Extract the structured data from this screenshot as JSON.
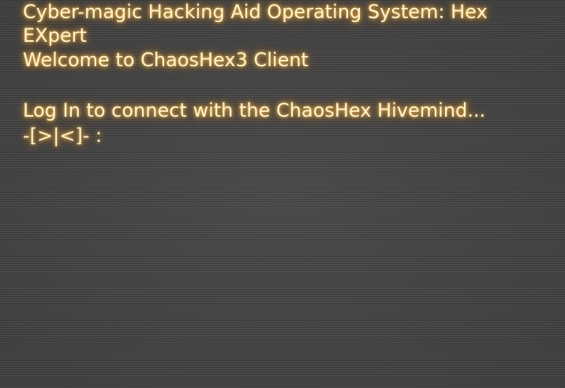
{
  "terminal": {
    "title_line": "Cyber-magic Hacking Aid Operating System: Hex EXpert",
    "welcome_line": "Welcome to ChaosHex3 Client",
    "login_line": "Log In to connect with the ChaosHex Hivemind...",
    "prompt": "-[>|<]- :",
    "input_value": ""
  },
  "colors": {
    "background": "#444444",
    "text": "#fff3cc",
    "glow": "#ffaa28"
  }
}
